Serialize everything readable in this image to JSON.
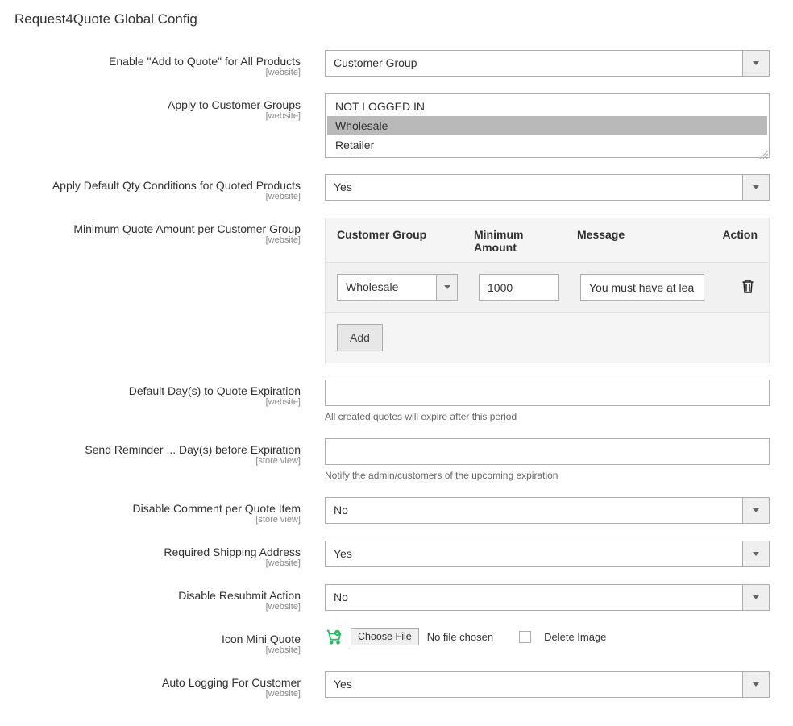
{
  "section_title": "Request4Quote Global Config",
  "scope_website": "[website]",
  "scope_storeview": "[store view]",
  "fields": {
    "enable_add_to_quote": {
      "label": "Enable \"Add to Quote\" for All Products",
      "value": "Customer Group"
    },
    "apply_customer_groups": {
      "label": "Apply to Customer Groups",
      "options": [
        "NOT LOGGED IN",
        "Wholesale",
        "Retailer"
      ]
    },
    "apply_default_qty": {
      "label": "Apply Default Qty Conditions for Quoted Products",
      "value": "Yes"
    },
    "min_quote_amount": {
      "label": "Minimum Quote Amount per Customer Group",
      "headers": {
        "group": "Customer Group",
        "amount": "Minimum Amount",
        "message": "Message",
        "action": "Action"
      },
      "row": {
        "group": "Wholesale",
        "amount": "1000",
        "message": "You must have at lea"
      },
      "add_btn": "Add"
    },
    "default_days_expiration": {
      "label": "Default Day(s) to Quote Expiration",
      "value": "",
      "note": "All created quotes will expire after this period"
    },
    "send_reminder": {
      "label": "Send Reminder ... Day(s) before Expiration",
      "value": "",
      "note": "Notify the admin/customers of the upcoming expiration"
    },
    "disable_comment": {
      "label": "Disable Comment per Quote Item",
      "value": "No"
    },
    "required_shipping": {
      "label": "Required Shipping Address",
      "value": "Yes"
    },
    "disable_resubmit": {
      "label": "Disable Resubmit Action",
      "value": "No"
    },
    "icon_mini_quote": {
      "label": "Icon Mini Quote",
      "choose_file": "Choose File",
      "no_file": "No file chosen",
      "delete_image": "Delete Image"
    },
    "auto_logging": {
      "label": "Auto Logging For Customer",
      "value": "Yes"
    }
  }
}
